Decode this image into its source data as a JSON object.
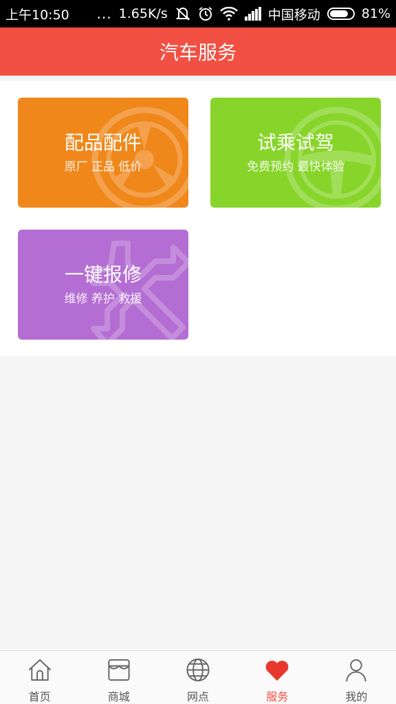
{
  "status_bar": {
    "time": "上午10:50",
    "dots": "...",
    "network_speed": "1.65K/s",
    "carrier": "中国移动",
    "battery": "81%",
    "battery_level": 0.81,
    "icons": [
      "mute-icon",
      "alarm-icon",
      "wifi-icon",
      "signal-icon",
      "battery-icon"
    ]
  },
  "header": {
    "title": "汽车服务"
  },
  "services": [
    {
      "title": "配品配件",
      "subtitle": "原厂 正品 低价",
      "color": "#f0871a",
      "icon": "wheel-icon"
    },
    {
      "title": "试乘试驾",
      "subtitle": "免费预约 最快体验",
      "color": "#87d52a",
      "icon": "steering-wheel-icon"
    },
    {
      "title": "一键报修",
      "subtitle": "维修 养护 救援",
      "color": "#b46ed3",
      "icon": "wrench-icon"
    }
  ],
  "tabbar": {
    "items": [
      {
        "label": "首页",
        "icon": "home-icon"
      },
      {
        "label": "商城",
        "icon": "store-icon"
      },
      {
        "label": "网点",
        "icon": "globe-icon"
      },
      {
        "label": "服务",
        "icon": "heart-icon",
        "active": true
      },
      {
        "label": "我的",
        "icon": "user-icon"
      }
    ],
    "active_color": "#f15042"
  }
}
